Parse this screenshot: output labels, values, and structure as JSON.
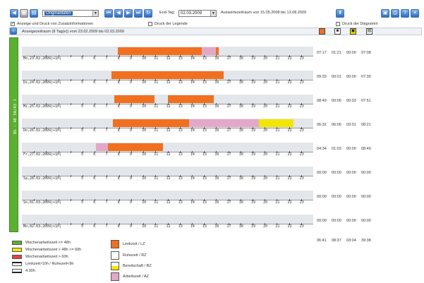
{
  "toolbar": {
    "view_select": "Originaldaten",
    "end_tag_label": "End-Tag:",
    "end_tag_value": "02.03.2009",
    "range_text": "Auswertezeitraum von 15.05.2008 bis 13.08.2009"
  },
  "options": {
    "zusatz_label": "Anzeige und Druck von Zusatzinformationen",
    "legende_label": "Druck der Legende",
    "diagram_label": "Druck der Diagramm"
  },
  "header": {
    "period": "Anzeigezeitraum (8 Tag(e)) vom 23.02.2009 bis 02.03.2009"
  },
  "side_label": "BS - AE 50/43 1",
  "hours": [
    "1",
    "2",
    "3",
    "4",
    "5",
    "6",
    "7",
    "8",
    "9",
    "10",
    "11",
    "12",
    "13",
    "14",
    "15",
    "16",
    "17",
    "18",
    "19",
    "20",
    "21",
    "22",
    "23"
  ],
  "days": [
    {
      "date": "Mo,23.02.2009|+1h|",
      "lz": "07:17",
      "rz": "01:21",
      "bz": "00:00",
      "tot": "07:08"
    },
    {
      "date": "Di,24.02.2009|+1h|",
      "lz": "09:29",
      "rz": "00:01",
      "bz": "00:00",
      "tot": "07:30"
    },
    {
      "date": "Mi,25.02.2009|+1h|",
      "lz": "08:49",
      "rz": "00:06",
      "bz": "00:03",
      "tot": "07:51"
    },
    {
      "date": "Do,26.02.2009|+1h|",
      "lz": "06:32",
      "rz": "06:06",
      "bz": "03:01",
      "tot": "08:21"
    },
    {
      "date": "Fr,27.02.2009|+1h|",
      "lz": "04:34",
      "rz": "01:03",
      "bz": "00:00",
      "tot": "08:49"
    },
    {
      "date": "Sa,28.02.2009|+1h|",
      "lz": "00:00",
      "rz": "00:00",
      "bz": "00:00",
      "tot": "00:00"
    },
    {
      "date": "So,01.03.2009|+1h|",
      "lz": "00:00",
      "rz": "00:00",
      "bz": "00:00",
      "tot": "00:00"
    },
    {
      "date": "Mo,02.03.2009|+1h|",
      "lz": "00:00",
      "rz": "00:00",
      "bz": "00:00",
      "tot": "00:00"
    }
  ],
  "totals": {
    "lz": "36:41",
    "rz": "08:37",
    "bz": "03:04",
    "tot": "39:38"
  },
  "legend": {
    "woche_ok": "Wochenarbeitszeit <= 48h",
    "woche_mid": "Wochenarbeitszeit > 48h <= 60h",
    "woche_high": "Wochenarbeitszeit > 60h",
    "lenk_ruhe": "Lenkzeit>10h / Ruhezeit<9h",
    "lenk_4": "4:30h",
    "lz": "Lenkzeit / LZ",
    "rz": "Ruhezeit / RZ",
    "bz": "Bereitschaft / BZ",
    "az": "Arbeitszeit / AZ"
  },
  "colors": {
    "lz": "#f07020",
    "rz": "#ffffff",
    "bz": "#f2e600",
    "az": "#e3a8c8",
    "green": "#5cb030"
  }
}
